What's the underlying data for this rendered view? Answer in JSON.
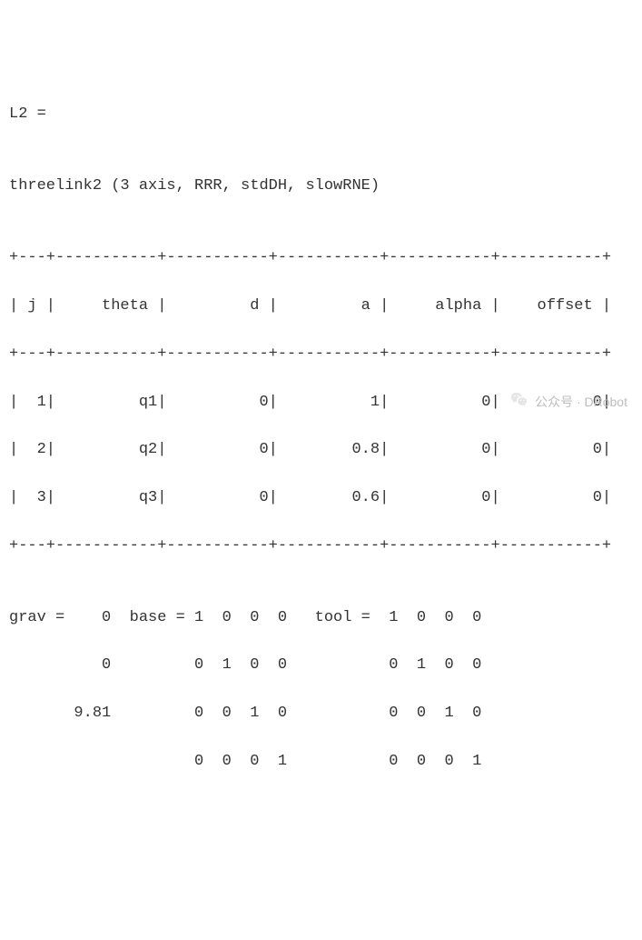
{
  "var_line": "L2 =",
  "blank": "",
  "desc_line": "threelink2 (3 axis, RRR, stdDH, slowRNE)",
  "table": {
    "border": "+---+-----------+-----------+-----------+-----------+-----------+",
    "header": "| j |     theta |         d |         a |     alpha |    offset |",
    "r1": "|  1|         q1|          0|          1|          0|          0|",
    "r2": "|  2|         q2|          0|        0.8|          0|          0|",
    "r3": "|  3|         q3|          0|        0.6|          0|          0|"
  },
  "mat": {
    "l1": "grav =    0  base = 1  0  0  0   tool =  1  0  0  0",
    "l2": "          0         0  1  0  0           0  1  0  0",
    "l3": "       9.81         0  0  1  0           0  0  1  0",
    "l4": "                    0  0  0  1           0  0  0  1"
  },
  "watermark": {
    "text": "公众号 · DRobot"
  },
  "chart_data": {
    "type": "table",
    "title": "threelink2 (3 axis, RRR, stdDH, slowRNE)",
    "columns": [
      "j",
      "theta",
      "d",
      "a",
      "alpha",
      "offset"
    ],
    "rows": [
      {
        "j": 1,
        "theta": "q1",
        "d": 0,
        "a": 1.0,
        "alpha": 0,
        "offset": 0
      },
      {
        "j": 2,
        "theta": "q2",
        "d": 0,
        "a": 0.8,
        "alpha": 0,
        "offset": 0
      },
      {
        "j": 3,
        "theta": "q3",
        "d": 0,
        "a": 0.6,
        "alpha": 0,
        "offset": 0
      }
    ],
    "grav": [
      0,
      0,
      9.81
    ],
    "base": [
      [
        1,
        0,
        0,
        0
      ],
      [
        0,
        1,
        0,
        0
      ],
      [
        0,
        0,
        1,
        0
      ],
      [
        0,
        0,
        0,
        1
      ]
    ],
    "tool": [
      [
        1,
        0,
        0,
        0
      ],
      [
        0,
        1,
        0,
        0
      ],
      [
        0,
        0,
        1,
        0
      ],
      [
        0,
        0,
        0,
        1
      ]
    ]
  }
}
